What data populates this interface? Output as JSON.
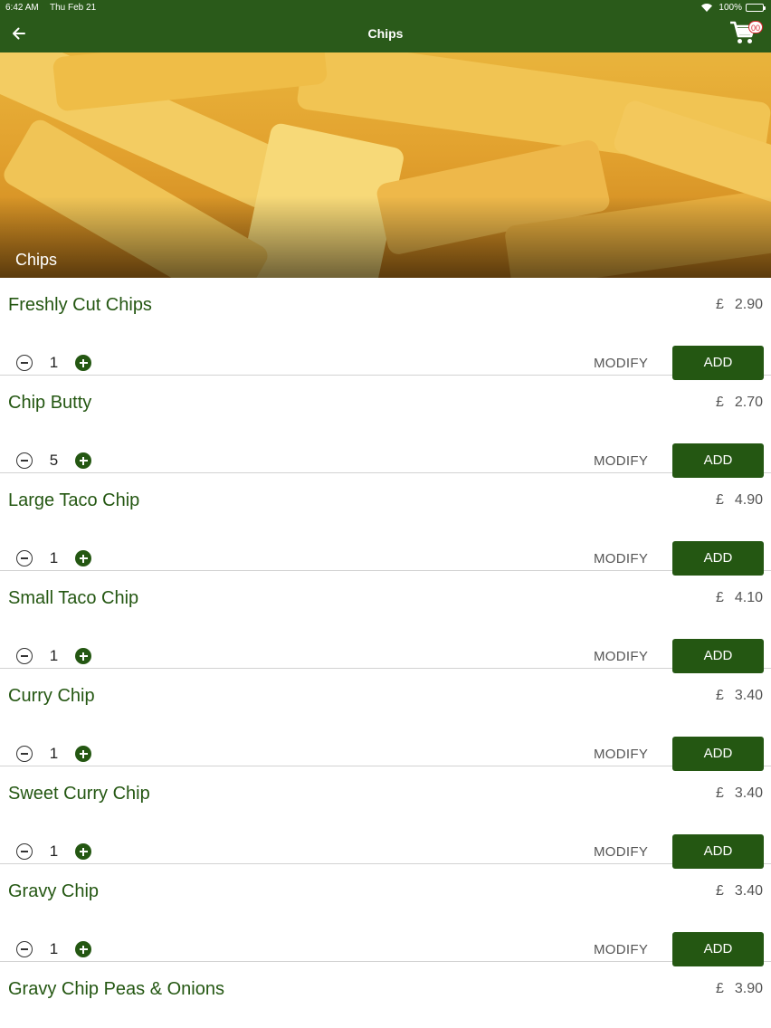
{
  "status_bar": {
    "time": "6:42 AM",
    "date": "Thu Feb 21",
    "battery": "100%"
  },
  "header": {
    "title": "Chips",
    "back_icon": "arrow-left-icon",
    "cart_icon": "shopping-cart-icon",
    "cart_count": "00"
  },
  "hero": {
    "label": "Chips"
  },
  "colors": {
    "brand": "#2a5a1a",
    "accent_green": "#245712",
    "badge_red": "#d8262f"
  },
  "items": [
    {
      "name": "Freshly Cut Chips",
      "currency": "£",
      "price": "2.90",
      "qty": "1",
      "modify": "MODIFY",
      "add": "ADD"
    },
    {
      "name": "Chip Butty",
      "currency": "£",
      "price": "2.70",
      "qty": "5",
      "modify": "MODIFY",
      "add": "ADD"
    },
    {
      "name": "Large Taco Chip",
      "currency": "£",
      "price": "4.90",
      "qty": "1",
      "modify": "MODIFY",
      "add": "ADD"
    },
    {
      "name": "Small Taco Chip",
      "currency": "£",
      "price": "4.10",
      "qty": "1",
      "modify": "MODIFY",
      "add": "ADD"
    },
    {
      "name": "Curry Chip",
      "currency": "£",
      "price": "3.40",
      "qty": "1",
      "modify": "MODIFY",
      "add": "ADD"
    },
    {
      "name": "Sweet Curry Chip",
      "currency": "£",
      "price": "3.40",
      "qty": "1",
      "modify": "MODIFY",
      "add": "ADD"
    },
    {
      "name": "Gravy Chip",
      "currency": "£",
      "price": "3.40",
      "qty": "1",
      "modify": "MODIFY",
      "add": "ADD"
    },
    {
      "name": "Gravy Chip Peas & Onions",
      "currency": "£",
      "price": "3.90"
    }
  ]
}
